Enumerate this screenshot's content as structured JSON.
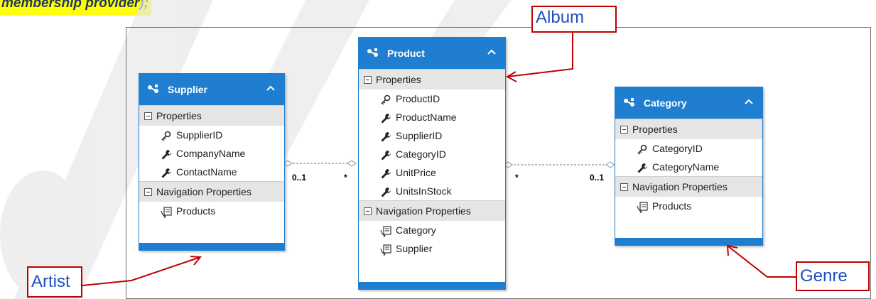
{
  "top_text": "membership provider);",
  "entities": {
    "supplier": {
      "title": "Supplier",
      "sections": [
        {
          "label": "Properties",
          "items": [
            {
              "name": "SupplierID",
              "icon": "key-icon"
            },
            {
              "name": "CompanyName",
              "icon": "wrench-icon"
            },
            {
              "name": "ContactName",
              "icon": "wrench-icon"
            }
          ]
        },
        {
          "label": "Navigation Properties",
          "items": [
            {
              "name": "Products",
              "icon": "navigation-property-icon"
            }
          ]
        }
      ]
    },
    "product": {
      "title": "Product",
      "sections": [
        {
          "label": "Properties",
          "items": [
            {
              "name": "ProductID",
              "icon": "key-icon"
            },
            {
              "name": "ProductName",
              "icon": "wrench-icon"
            },
            {
              "name": "SupplierID",
              "icon": "wrench-icon"
            },
            {
              "name": "CategoryID",
              "icon": "wrench-icon"
            },
            {
              "name": "UnitPrice",
              "icon": "wrench-icon"
            },
            {
              "name": "UnitsInStock",
              "icon": "wrench-icon"
            }
          ]
        },
        {
          "label": "Navigation Properties",
          "items": [
            {
              "name": "Category",
              "icon": "navigation-property-icon"
            },
            {
              "name": "Supplier",
              "icon": "navigation-property-icon"
            }
          ]
        }
      ]
    },
    "category": {
      "title": "Category",
      "sections": [
        {
          "label": "Properties",
          "items": [
            {
              "name": "CategoryID",
              "icon": "key-icon"
            },
            {
              "name": "CategoryName",
              "icon": "wrench-icon"
            }
          ]
        },
        {
          "label": "Navigation Properties",
          "items": [
            {
              "name": "Products",
              "icon": "navigation-property-icon"
            }
          ]
        }
      ]
    }
  },
  "associations": {
    "supplier_product": {
      "left": "0..1",
      "right": "*"
    },
    "product_category": {
      "left": "*",
      "right": "0..1"
    }
  },
  "callouts": {
    "album": "Album",
    "artist": "Artist",
    "genre": "Genre"
  },
  "colors": {
    "entity_blue": "#1f7ed0",
    "callout_border": "#c00000",
    "callout_text": "#1f4fbf",
    "highlight": "#ffff00"
  }
}
